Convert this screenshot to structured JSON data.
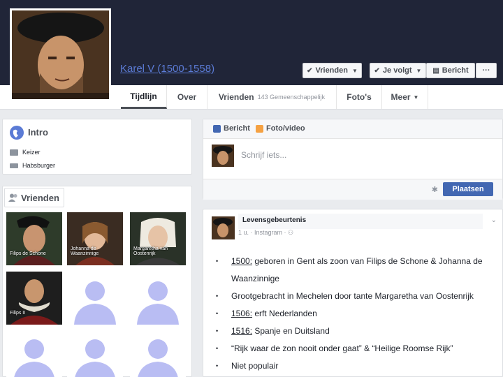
{
  "profile": {
    "name": "Karel V (1500-1558)"
  },
  "cover_buttons": {
    "friends": "Vrienden",
    "following": "Je volgt",
    "message": "Bericht",
    "more": "···"
  },
  "tabs": [
    {
      "label": "Tijdlijn"
    },
    {
      "label": "Over"
    },
    {
      "label": "Vrienden",
      "sub": "143 Gemeenschappelijk"
    },
    {
      "label": "Foto's"
    },
    {
      "label": "Meer"
    }
  ],
  "intro": {
    "title": "Intro",
    "items": [
      "Keizer",
      "Habsburger"
    ]
  },
  "friends": {
    "title": "Vrienden",
    "items": [
      {
        "label": "Filips de Schone"
      },
      {
        "label": "Johanna de Waanzinnige"
      },
      {
        "label": "Margaretha van Oostenrijk"
      },
      {
        "label": "Filips II"
      }
    ]
  },
  "composer": {
    "tab_post": "Bericht",
    "tab_photo": "Foto/video",
    "placeholder": "Schrijf iets...",
    "submit": "Plaatsen"
  },
  "post": {
    "title": "Levensgebeurtenis",
    "meta": "1 u. · Instagram · ",
    "bullets": [
      {
        "pre": "1500:",
        "text": " geboren in Gent als zoon van Filips de Schone & Johanna de Waanzinnige"
      },
      {
        "pre": "",
        "text": "Grootgebracht in Mechelen door tante Margaretha van Oostenrijk"
      },
      {
        "pre": "1506:",
        "text": " erft Nederlanden"
      },
      {
        "pre": "1516:",
        "text": " Spanje en Duitsland"
      },
      {
        "pre": "",
        "text": "“Rijk waar de zon nooit onder gaat” & “Heilige Roomse Rijk”"
      },
      {
        "pre": "",
        "text": "Niet populair"
      }
    ]
  },
  "colors": {
    "cover": "#202538",
    "link": "#5b7bd5",
    "primary_button": "#4267b2",
    "placeholder_silhouette": "#b9bdf3"
  }
}
